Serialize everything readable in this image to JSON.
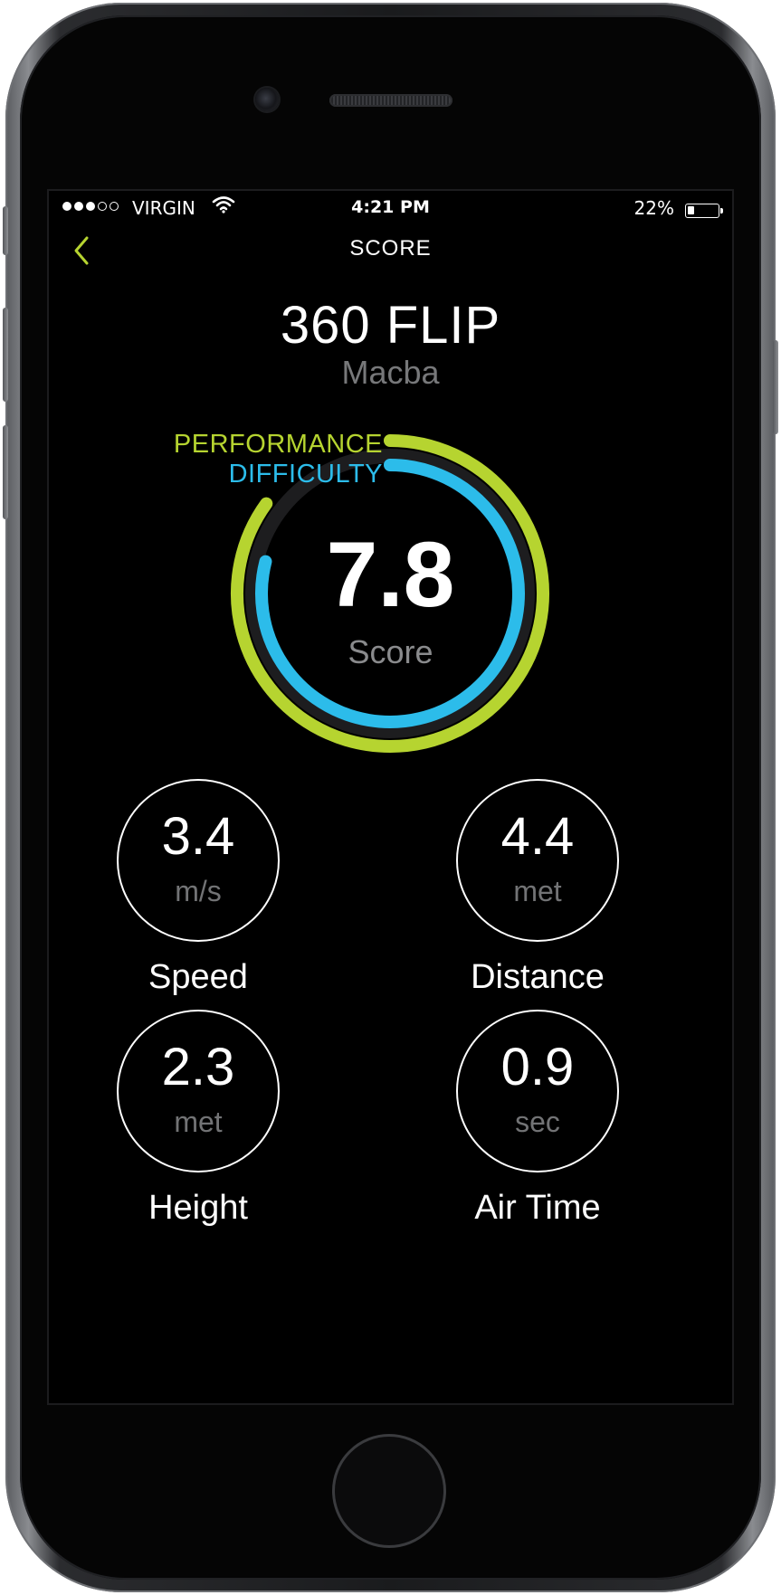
{
  "status_bar": {
    "signal_filled": 3,
    "signal_total": 5,
    "carrier": "VIRGIN",
    "time": "4:21 PM",
    "battery_percent_text": "22%",
    "battery_level": 0.22
  },
  "nav": {
    "back_icon": "chevron-left-icon",
    "title": "SCORE"
  },
  "trick": {
    "name": "360 FLIP",
    "location": "Macba"
  },
  "score": {
    "value": "7.8",
    "label": "Score",
    "legend": {
      "performance": "PERFORMANCE",
      "difficulty": "DIFFICULTY"
    },
    "performance_fraction": 0.85,
    "difficulty_fraction": 0.79,
    "colors": {
      "performance": "#b6d430",
      "difficulty": "#2cbcea",
      "track": "#1d1d1f"
    }
  },
  "stats": [
    {
      "value": "3.4",
      "unit": "m/s",
      "label": "Speed"
    },
    {
      "value": "4.4",
      "unit": "met",
      "label": "Distance"
    },
    {
      "value": "2.3",
      "unit": "met",
      "label": "Height"
    },
    {
      "value": "0.9",
      "unit": "sec",
      "label": "Air Time"
    }
  ],
  "colors": {
    "accent": "#b6d430",
    "background": "#000000"
  }
}
